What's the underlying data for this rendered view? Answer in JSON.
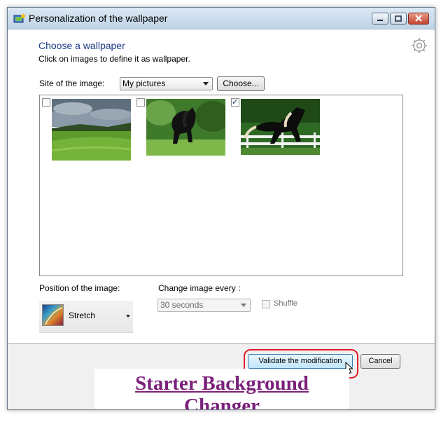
{
  "window": {
    "title": "Personalization of the wallpaper",
    "controls": [
      "minimize-icon",
      "maximize-icon",
      "close-icon"
    ]
  },
  "header": {
    "heading": "Choose a wallpaper",
    "subtext": "Click on images to define it as wallpaper.",
    "settings_icon": "gear-icon"
  },
  "source": {
    "label": "Site of the image:",
    "selected": "My pictures",
    "choose_button": "Choose..."
  },
  "gallery": {
    "images": [
      {
        "name": "green-meadow-thumbnail",
        "checked": false
      },
      {
        "name": "black-horse-grass-thumbnail",
        "checked": false
      },
      {
        "name": "black-horse-fence-thumbnail",
        "checked": true
      }
    ],
    "check_mark": "✓"
  },
  "position": {
    "label": "Position of the image:",
    "selected": "Stretch"
  },
  "interval": {
    "label": "Change image every :",
    "selected": "30 seconds",
    "enabled": false
  },
  "shuffle": {
    "label": "Shuffle",
    "checked": false,
    "enabled": false
  },
  "footer": {
    "validate_label": "Validate the modification",
    "cancel_label": "Cancel"
  },
  "banner": {
    "line1": "Starter Background",
    "line2": "Changer"
  },
  "colors": {
    "heading": "#1c3a87",
    "highlight": "#e0202a",
    "banner_text": "#7a1f7a"
  }
}
